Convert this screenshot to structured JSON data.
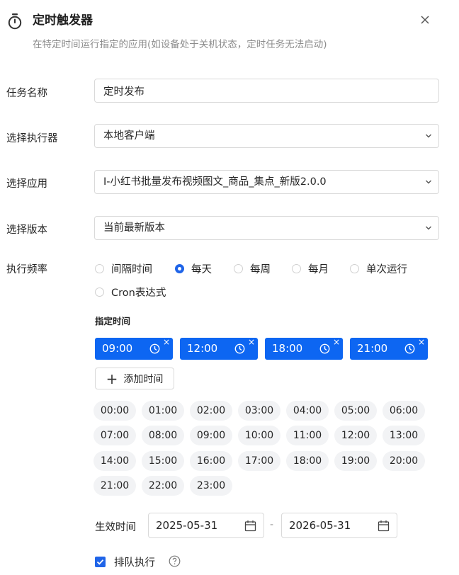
{
  "header": {
    "title": "定时触发器",
    "subtitle": "在特定时间运行指定的应用(如设备处于关机状态，定时任务无法启动)"
  },
  "form": {
    "task_name": {
      "label": "任务名称",
      "value": "定时发布"
    },
    "executor": {
      "label": "选择执行器",
      "value": "本地客户端"
    },
    "app": {
      "label": "选择应用",
      "value": "I-小红书批量发布视频图文_商品_集点_新版2.0.0"
    },
    "version": {
      "label": "选择版本",
      "value": "当前最新版本"
    },
    "frequency": {
      "label": "执行频率",
      "options": [
        "间隔时间",
        "每天",
        "每周",
        "每月",
        "单次运行",
        "Cron表达式"
      ],
      "selected": "每天"
    }
  },
  "schedule": {
    "title": "指定时间",
    "selected_times": [
      "09:00",
      "12:00",
      "18:00",
      "21:00"
    ],
    "add_label": "添加时间",
    "quick_times": [
      "00:00",
      "01:00",
      "02:00",
      "03:00",
      "04:00",
      "05:00",
      "06:00",
      "07:00",
      "08:00",
      "09:00",
      "10:00",
      "11:00",
      "12:00",
      "13:00",
      "14:00",
      "15:00",
      "16:00",
      "17:00",
      "18:00",
      "19:00",
      "20:00",
      "21:00",
      "22:00",
      "23:00"
    ]
  },
  "effective": {
    "label": "生效时间",
    "start": "2025-05-31",
    "separator": "-",
    "end": "2026-05-31"
  },
  "queue": {
    "label": "排队执行",
    "checked": true
  },
  "colors": {
    "primary": "#0d66f2",
    "chip_bg": "#f2f3f5",
    "border": "#d9d9d9"
  }
}
